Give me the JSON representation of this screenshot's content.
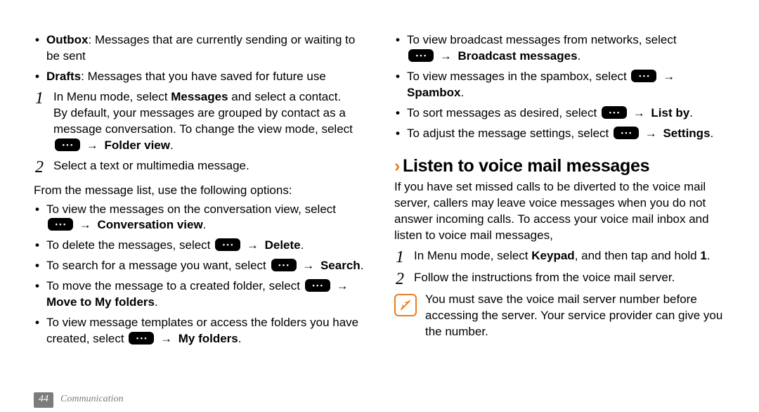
{
  "footer": {
    "page_number": "44",
    "section_name": "Communication"
  },
  "left": {
    "outbox_label": "Outbox",
    "outbox_desc": ": Messages that are currently sending or waiting to be sent",
    "drafts_label": "Drafts",
    "drafts_desc": ": Messages that you have saved for future use",
    "step1_a": "In Menu mode, select ",
    "step1_b": "Messages",
    "step1_c": " and select a contact.",
    "step1_body": "By default, your messages are grouped by contact as a message conversation. To change the view mode, select ",
    "step1_arrow": "→",
    "step1_bold_end": " Folder view",
    "step1_period": ".",
    "step2": "Select a text or multimedia message.",
    "list_intro": "From the message list, use the following options:",
    "li_conv_a": "To view the messages on the conversation view, select ",
    "li_conv_bold": " Conversation view",
    "li_conv_arrow": "→",
    "li_del_a": "To delete the messages, select ",
    "li_del_arrow": "→",
    "li_del_bold": " Delete",
    "li_search_a": "To search for a message you want, select ",
    "li_search_arrow": "→",
    "li_search_bold": "Search",
    "li_move_a": "To move the message to a created folder, select ",
    "li_move_arrow": "→",
    "li_move_bold": "Move to My folders",
    "li_tmpl_a": "To view message templates or access the folders you have created, select ",
    "li_tmpl_arrow": "→",
    "li_tmpl_bold": " My folders",
    "period": "."
  },
  "right": {
    "li_broadcast_a": "To view broadcast messages from networks, select ",
    "li_broadcast_arrow": "→",
    "li_broadcast_bold": " Broadcast messages",
    "li_spam_a": "To view messages in the spambox, select ",
    "li_spam_arrow": "→",
    "li_spam_bold": "Spambox",
    "li_sort_a": "To sort messages as desired, select ",
    "li_sort_arrow": "→",
    "li_sort_bold": " List by",
    "li_settings_a": "To adjust the message settings, select ",
    "li_settings_arrow": "→",
    "li_settings_bold": " Settings",
    "period": ".",
    "heading": "Listen to voice mail messages",
    "vm_intro": "If you have set missed calls to be diverted to the voice mail server, callers may leave voice messages when you do not answer incoming calls. To access your voice mail inbox and listen to voice mail messages,",
    "vm_step1_a": "In Menu mode, select ",
    "vm_step1_b": "Keypad",
    "vm_step1_c": ", and then tap and hold ",
    "vm_step1_d": "1",
    "vm_step1_e": ".",
    "vm_step2": "Follow the instructions from the voice mail server.",
    "note": "You must save the voice mail server number before accessing the server. Your service provider can give you the number."
  }
}
